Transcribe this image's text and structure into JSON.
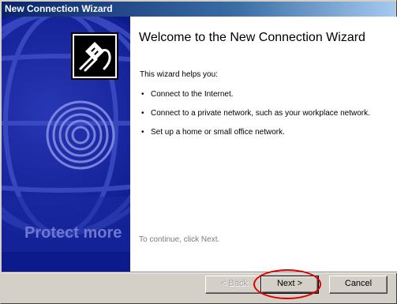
{
  "window": {
    "title": "New Connection Wizard"
  },
  "left_panel": {
    "watermark_text": "Protect more",
    "icon": "network-cable-icon",
    "bg_color": "#0c1a8c"
  },
  "content": {
    "heading": "Welcome to the New Connection Wizard",
    "intro": "This wizard helps you:",
    "bullets": [
      "Connect to the Internet.",
      "Connect to a private network, such as your workplace network.",
      "Set up a home or small office network."
    ],
    "continue_hint": "To continue, click Next."
  },
  "buttons": {
    "back": "< Back",
    "next": "Next >",
    "cancel": "Cancel"
  },
  "colors": {
    "title_bar": "#0a246a",
    "highlight": "#e00000"
  }
}
